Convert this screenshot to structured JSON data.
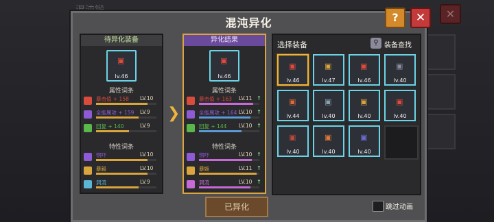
{
  "background": {
    "title_fragment": "混沌锻",
    "close_glyph": "✕"
  },
  "dialog": {
    "title": "混沌异化",
    "help_glyph": "?",
    "close_glyph": "✕"
  },
  "left_column": {
    "header": "待异化装备",
    "item_level": "lv.46",
    "attr_title": "属性词条",
    "attrs": [
      {
        "name": "暴击值 + 158",
        "level": "LV.10",
        "color": "#d94b3c",
        "fill": 0.85
      },
      {
        "name": "全能属攻 + 159",
        "level": "LV.9",
        "color": "#8e5ad6",
        "fill": 0.7
      },
      {
        "name": "回复 + 140",
        "level": "LV.9",
        "color": "#5ab84a",
        "fill": 0.55
      }
    ],
    "trait_title": "特性词条",
    "traits": [
      {
        "name": "恫吓",
        "level": "LV.10",
        "color": "#8e5ad6",
        "fill": 0.85
      },
      {
        "name": "暴毅",
        "level": "LV.10",
        "color": "#d9a53c",
        "fill": 0.85
      },
      {
        "name": "洞流",
        "level": "LV.9",
        "color": "#5ab8d6",
        "fill": 0.7
      }
    ]
  },
  "right_column": {
    "header": "异化结果",
    "item_level": "lv.46",
    "attr_title": "属性词条",
    "attrs": [
      {
        "name": "暴击值 + 163",
        "level": "LV.11",
        "color": "#d94b3c",
        "fill": 0.9,
        "bar_color": "#c86ad6"
      },
      {
        "name": "全能属攻 + 164",
        "level": "LV.10",
        "color": "#8e5ad6",
        "fill": 0.85,
        "bar_color": "#5a9ad6"
      },
      {
        "name": "回复 + 144",
        "level": "LV.10",
        "color": "#5ab84a",
        "fill": 0.7,
        "bar_color": "#5a9ad6"
      }
    ],
    "trait_title": "特性词条",
    "traits": [
      {
        "name": "恫吓",
        "level": "LV.10",
        "color": "#8e5ad6",
        "fill": 0.88,
        "bar_color": "#c86ad6"
      },
      {
        "name": "暴姬",
        "level": "LV.11",
        "color": "#d9a53c",
        "fill": 0.95,
        "bar_color": "#d9a53c"
      },
      {
        "name": "洞流",
        "level": "LV.10",
        "color": "#c86ad6",
        "fill": 0.85,
        "bar_color": "#c86ad6"
      }
    ],
    "up_arrow": "↑"
  },
  "select_panel": {
    "title": "选择装备",
    "search_label": "装备查找",
    "items": [
      {
        "level": "lv.46",
        "selected": true
      },
      {
        "level": "lv.47",
        "selected": false
      },
      {
        "level": "lv.46",
        "selected": false
      },
      {
        "level": "lv.40",
        "selected": false
      },
      {
        "level": "lv.44",
        "selected": false
      },
      {
        "level": "lv.40",
        "selected": false
      },
      {
        "level": "lv.40",
        "selected": false
      },
      {
        "level": "lv.40",
        "selected": false
      },
      {
        "level": "lv.40",
        "selected": false
      },
      {
        "level": "lv.40",
        "selected": false
      },
      {
        "level": "lv.40",
        "selected": false
      }
    ]
  },
  "footer": {
    "done_label": "已异化",
    "skip_label": "跳过动画"
  },
  "transfer_arrow": "❯",
  "colors": {
    "accent_gold": "#d9a53c",
    "selected_border": "#f0b43c",
    "item_border": "#6bd4e6",
    "left_header": "#6a6a6c",
    "right_header": "#a080d0"
  }
}
